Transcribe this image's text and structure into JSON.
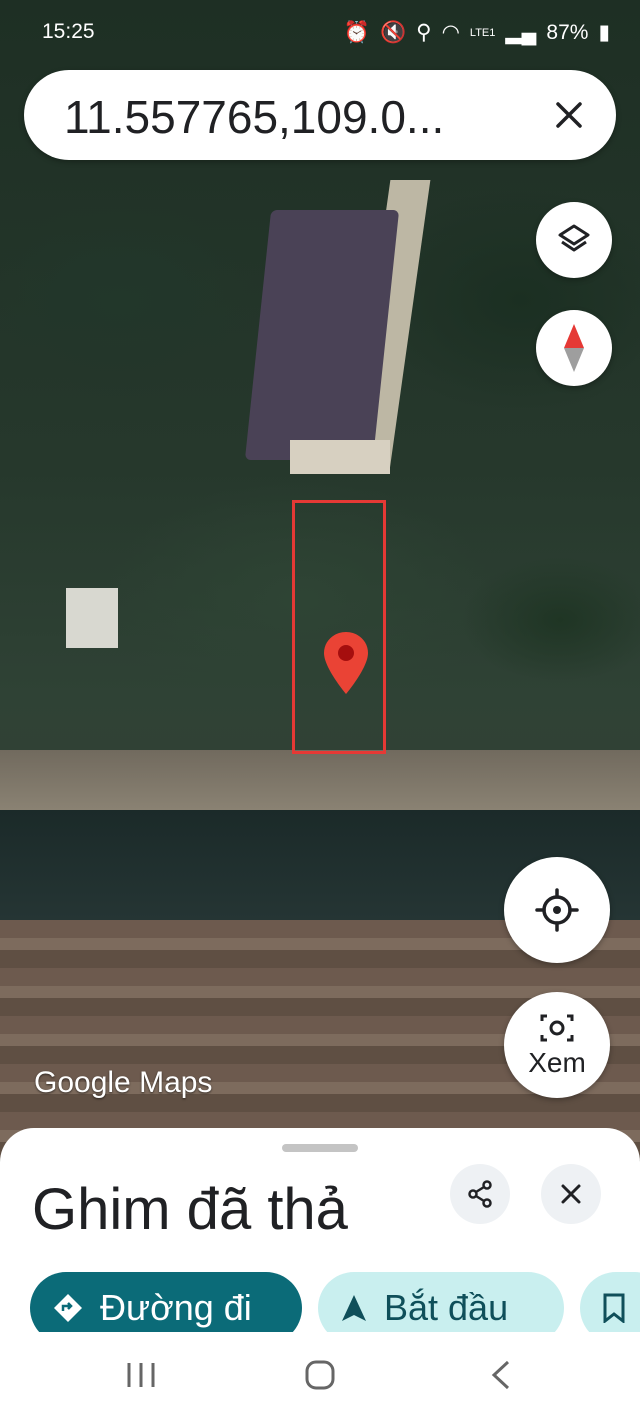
{
  "status_bar": {
    "time": "15:25",
    "battery": "87%",
    "network": "LTE1"
  },
  "search": {
    "value": "11.557765,109.0..."
  },
  "map": {
    "logo_text": "Google Maps"
  },
  "controls": {
    "view_label": "Xem"
  },
  "sheet": {
    "title": "Ghim đã thả",
    "chips": {
      "directions": "Đường đi",
      "start": "Bắt đầu"
    }
  },
  "colors": {
    "pin": "#ea4335",
    "highlight_box": "#e53935",
    "chip_primary": "#0b6b78",
    "chip_secondary": "#c9efef"
  }
}
